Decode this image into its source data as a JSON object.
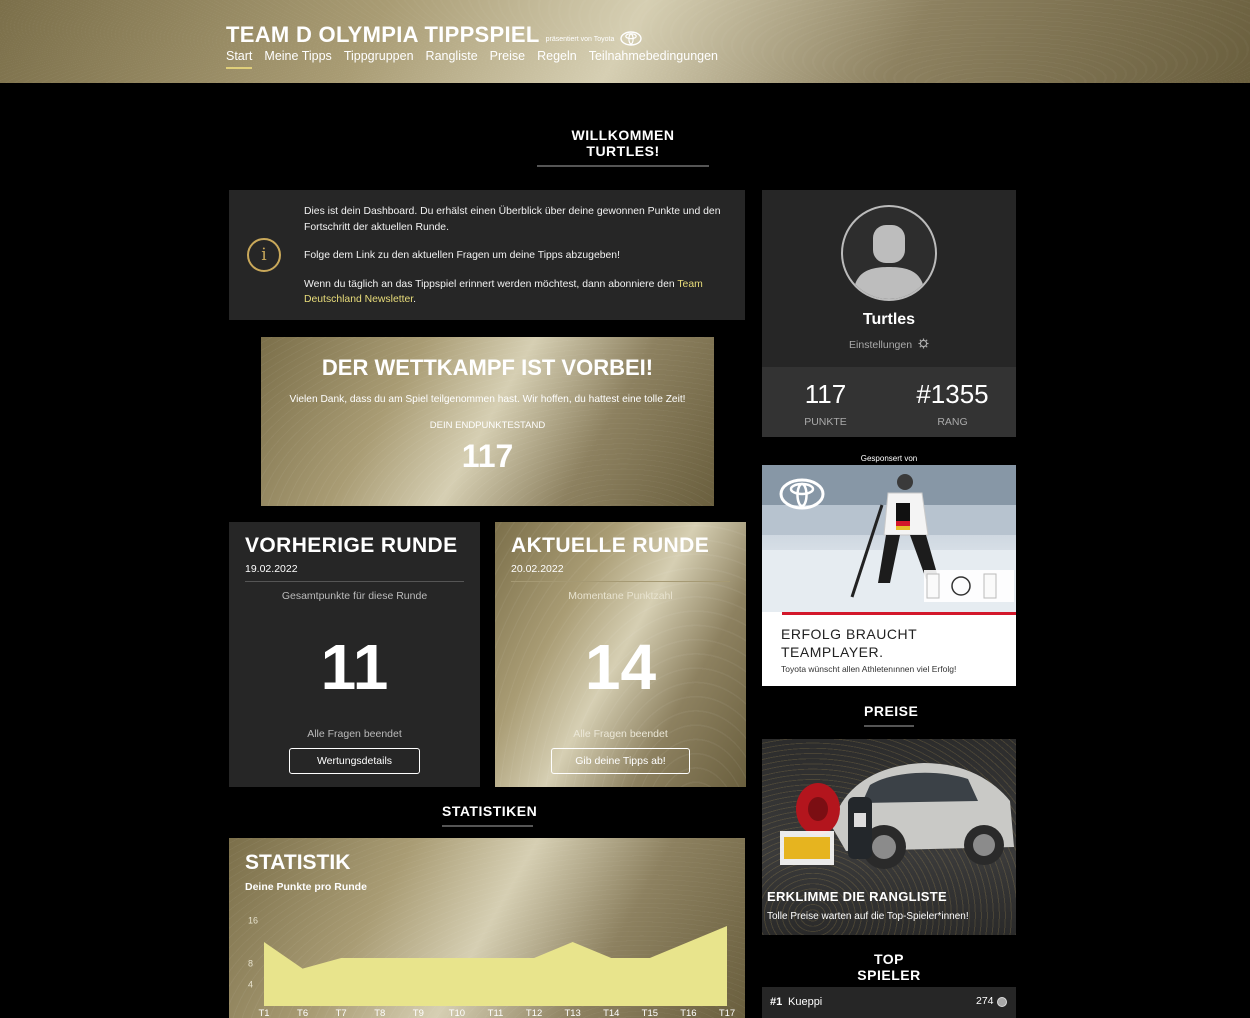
{
  "header": {
    "title": "TEAM D OLYMPIA TIPPSPIEL",
    "subtitle": "präsentiert von Toyota",
    "nav": [
      "Start",
      "Meine Tipps",
      "Tippgruppen",
      "Rangliste",
      "Preise",
      "Regeln",
      "Teilnahmebedingungen"
    ],
    "active_nav": "Start"
  },
  "welcome": "WILLKOMMEN TURTLES!",
  "info": {
    "p1": "Dies ist dein Dashboard. Du erhälst einen Überblick über deine gewonnen Punkte und den Fortschritt der aktuellen Runde.",
    "p2": "Folge dem Link zu den aktuellen Fragen um deine Tipps abzugeben!",
    "p3_prefix": "Wenn du täglich an das Tippspiel erinnert werden möchtest, dann abonniere den ",
    "p3_link": "Team Deutschland Newsletter",
    "p3_suffix": ".",
    "icon": "i"
  },
  "final": {
    "title": "DER WETTKAMPF IST VORBEI!",
    "text": "Vielen Dank, dass du am Spiel teilgenommen hast. Wir hoffen, du hattest eine tolle Zeit!",
    "label": "DEIN ENDPUNKTESTAND",
    "value": "117"
  },
  "previous_round": {
    "title": "VORHERIGE RUNDE",
    "date": "19.02.2022",
    "label": "Gesamtpunkte für diese Runde",
    "value": "11",
    "status": "Alle Fragen beendet",
    "button": "Wertungsdetails"
  },
  "current_round": {
    "title": "AKTUELLE RUNDE",
    "date": "20.02.2022",
    "label": "Momentane Punktzahl",
    "value": "14",
    "status": "Alle Fragen beendet",
    "button": "Gib deine Tipps ab!"
  },
  "statistics_heading": "STATISTIKEN",
  "statistics": {
    "title": "STATISTIK",
    "subtitle": "Deine Punkte pro Runde"
  },
  "chart_data": {
    "type": "area",
    "x": [
      "T1",
      "T6",
      "T7",
      "T8",
      "T9",
      "T10",
      "T11",
      "T12",
      "T13",
      "T14",
      "T15",
      "T16",
      "T17"
    ],
    "values": [
      12,
      7,
      9,
      9,
      9,
      9,
      9,
      9,
      12,
      9,
      9,
      12,
      15
    ],
    "yticks": [
      "4",
      "8",
      "16"
    ],
    "ylim": [
      0,
      18
    ],
    "color": "#e8e48c"
  },
  "profile": {
    "name": "Turtles",
    "settings": "Einstellungen",
    "points": "117",
    "points_label": "PUNKTE",
    "rank": "#1355",
    "rank_label": "RANG"
  },
  "sponsor": {
    "label": "Gesponsert von",
    "headline_line1": "ERFOLG BRAUCHT",
    "headline_line2": "TEAMPLAYER.",
    "tagline": "Toyota wünscht allen Athletenınnen viel Erfolg!"
  },
  "prizes_heading": "PREISE",
  "prizes": {
    "title": "ERKLIMME DIE RANGLISTE",
    "text": "Tolle Preise warten auf die Top-Spieler*innen!"
  },
  "top_players_heading": "TOP SPIELER",
  "top_players": [
    {
      "rank": "#1",
      "name": "Kueppi",
      "score": "274"
    }
  ],
  "colors": {
    "accent_gold": "#c9a85a",
    "link_yellow": "#e8dc7a",
    "panel": "#262626",
    "toyota_red": "#d3182b"
  }
}
